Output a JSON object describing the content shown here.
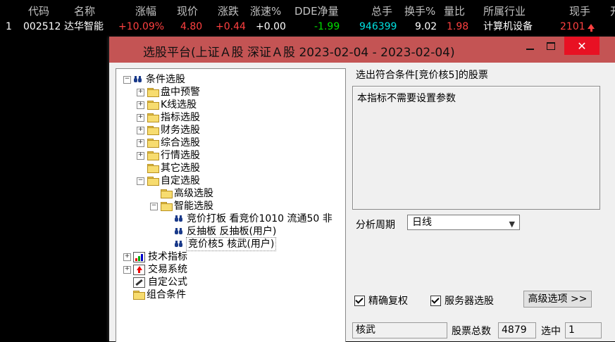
{
  "header": {
    "code": "代码",
    "name": "名称",
    "change_pct": "涨幅",
    "price": "现价",
    "change": "涨跌",
    "speed": "涨速%",
    "dde": "DDE净量",
    "volume": "总手",
    "turnover": "换手%",
    "vol_ratio": "量比",
    "industry": "所属行业",
    "current_vol": "现手",
    "extra": "开"
  },
  "stock_row": {
    "index": "1",
    "code": "002512",
    "name": "达华智能",
    "change_pct": "+10.09%",
    "price": "4.80",
    "change": "+0.44",
    "speed": "+0.00",
    "dde": "-1.99",
    "volume": "946399",
    "turnover": "9.02",
    "vol_ratio": "1.98",
    "industry": "计算机设备",
    "current_vol": "2101"
  },
  "dialog": {
    "title": "选股平台(上证Ａ股 深证Ａ股   2023-02-04 - 2023-02-04)",
    "close": "✕",
    "tree": {
      "root": "条件选股",
      "items": [
        "盘中预警",
        "K线选股",
        "指标选股",
        "财务选股",
        "综合选股",
        "行情选股",
        "其它选股",
        "自定选股"
      ],
      "custom_children": [
        "高级选股",
        "智能选股"
      ],
      "smart_children": [
        "竞价打板  看竞价1010  流通50  非",
        "反抽板  反抽板(用户)",
        "竞价核5  核武(用户)"
      ],
      "bottom": [
        "技术指标",
        "交易系统",
        "自定公式",
        "组合条件"
      ]
    },
    "result_label": "选出符合条件[竞价核5]的股票",
    "description": "本指标不需要设置参数",
    "period_label": "分析周期",
    "period_value": "日线",
    "chk_exact": "精确复权",
    "chk_server": "服务器选股",
    "adv_button": "高级选项 >>",
    "formula_name": "核武",
    "total_label": "股票总数",
    "total_value": "4879",
    "selected_label": "选中",
    "selected_value": "1"
  },
  "colors": {
    "titlebar": "#c45454",
    "up": "#ff4040",
    "down": "#00e000",
    "volume": "#00e0e0"
  }
}
